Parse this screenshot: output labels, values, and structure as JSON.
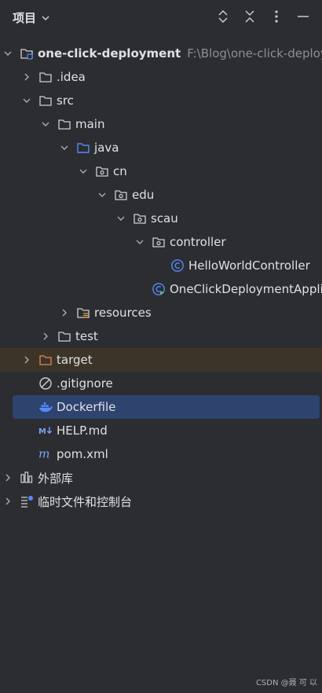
{
  "header": {
    "title": "项目",
    "tools": [
      "expand-all-icon",
      "collapse-all-icon",
      "more-options-icon",
      "minimize-icon"
    ]
  },
  "tree": [
    {
      "label": "one-click-deployment",
      "path": "F:\\Blog\\one-click-deployment",
      "icon": "module-folder-icon",
      "expanded": true,
      "bold": true
    },
    {
      "label": ".idea",
      "icon": "folder-icon",
      "expanded": false
    },
    {
      "label": "src",
      "icon": "folder-icon",
      "expanded": true
    },
    {
      "label": "main",
      "icon": "folder-icon",
      "expanded": true
    },
    {
      "label": "java",
      "icon": "source-folder-icon",
      "expanded": true
    },
    {
      "label": "cn",
      "icon": "package-icon",
      "expanded": true
    },
    {
      "label": "edu",
      "icon": "package-icon",
      "expanded": true
    },
    {
      "label": "scau",
      "icon": "package-icon",
      "expanded": true
    },
    {
      "label": "controller",
      "icon": "package-icon",
      "expanded": true
    },
    {
      "label": "HelloWorldController",
      "icon": "java-class-icon"
    },
    {
      "label": "OneClickDeploymentApplication",
      "icon": "spring-boot-app-icon"
    },
    {
      "label": "resources",
      "icon": "resources-folder-icon",
      "expanded": false
    },
    {
      "label": "test",
      "icon": "folder-icon",
      "expanded": false
    },
    {
      "label": "target",
      "icon": "excluded-folder-icon",
      "expanded": false
    },
    {
      "label": ".gitignore",
      "icon": "gitignore-icon"
    },
    {
      "label": "Dockerfile",
      "icon": "docker-icon"
    },
    {
      "label": "HELP.md",
      "icon": "markdown-icon"
    },
    {
      "label": "pom.xml",
      "icon": "maven-icon"
    },
    {
      "label": "外部库",
      "icon": "external-libraries-icon",
      "expanded": false
    },
    {
      "label": "临时文件和控制台",
      "icon": "scratches-icon",
      "expanded": false
    }
  ],
  "footer": "CSDN @聂 可 以",
  "colors": {
    "background": "#2b2d30",
    "selection": "#2e436e",
    "excluded_row": "#3d3428",
    "text": "#dfe1e5",
    "path_text": "#8c8f94",
    "accent_blue": "#548af7"
  }
}
